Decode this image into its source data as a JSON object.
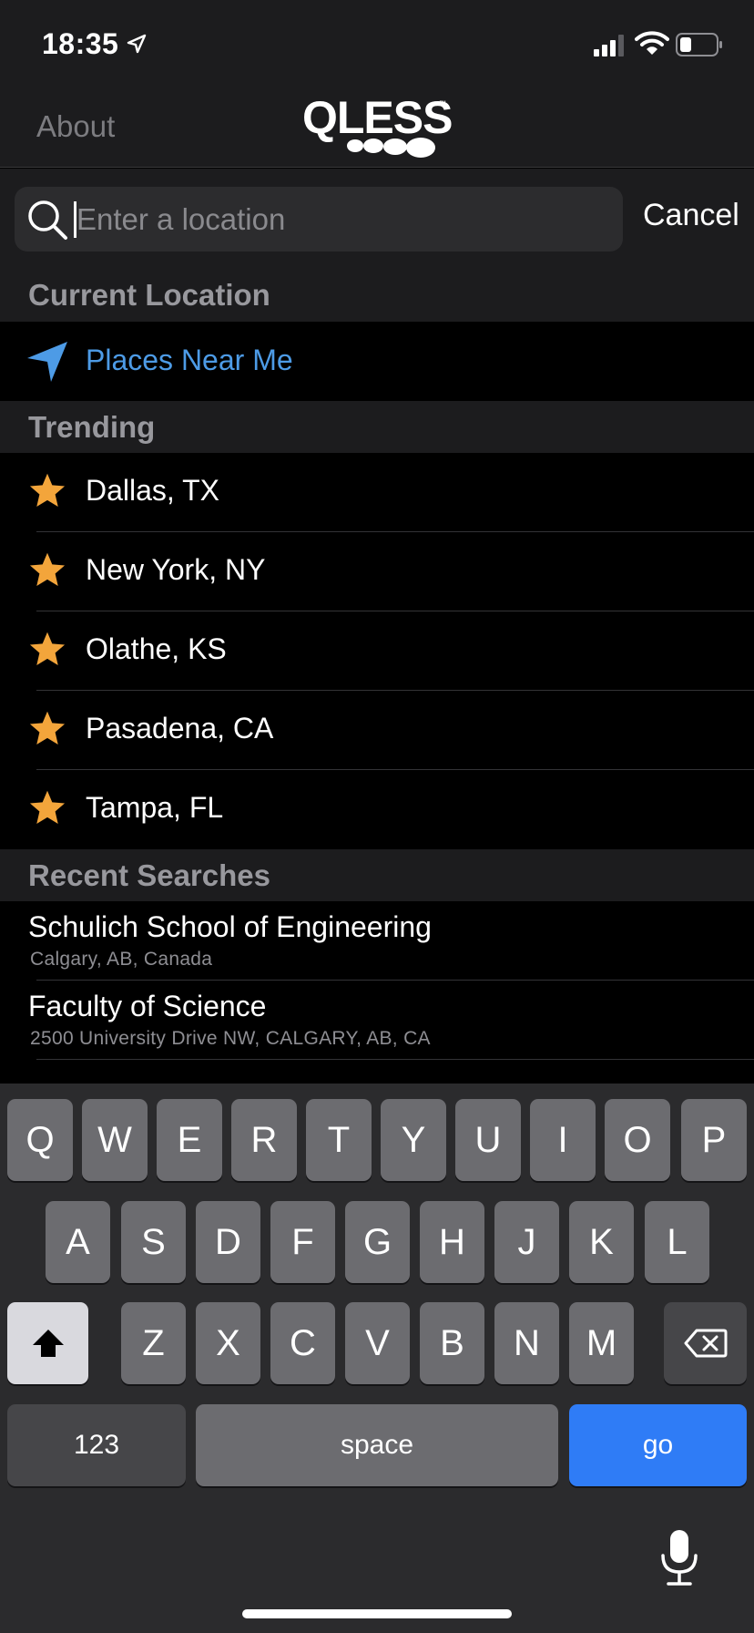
{
  "status_bar": {
    "time": "18:35"
  },
  "nav": {
    "about_label": "About",
    "logo_text": "QLESS",
    "logo_tm": "™"
  },
  "search": {
    "placeholder": "Enter a location",
    "value": "",
    "cancel_label": "Cancel"
  },
  "sections": {
    "current_location": "Current Location",
    "trending": "Trending",
    "recent": "Recent Searches"
  },
  "current_location": {
    "label": "Places Near Me"
  },
  "trending": [
    {
      "label": "Dallas, TX"
    },
    {
      "label": "New York, NY"
    },
    {
      "label": "Olathe, KS"
    },
    {
      "label": "Pasadena, CA"
    },
    {
      "label": "Tampa, FL"
    }
  ],
  "recent_searches": [
    {
      "title": "Schulich School of Engineering",
      "subtitle": "Calgary, AB, Canada"
    },
    {
      "title": "Faculty of Science",
      "subtitle": "2500 University Drive NW, CALGARY, AB, CA"
    }
  ],
  "keyboard": {
    "row1": [
      "Q",
      "W",
      "E",
      "R",
      "T",
      "Y",
      "U",
      "I",
      "O",
      "P"
    ],
    "row2": [
      "A",
      "S",
      "D",
      "F",
      "G",
      "H",
      "J",
      "K",
      "L"
    ],
    "row3": [
      "Z",
      "X",
      "C",
      "V",
      "B",
      "N",
      "M"
    ],
    "numbers_label": "123",
    "space_label": "space",
    "go_label": "go"
  },
  "colors": {
    "accent_blue": "#4d9be6",
    "star_orange": "#f3a53b",
    "go_key_blue": "#2f7cf6"
  },
  "icons": {
    "location": "location-arrow-icon",
    "signal": "cellular-signal-icon",
    "wifi": "wifi-icon",
    "battery": "battery-icon",
    "search": "search-icon",
    "near_me": "navigation-arrow-icon",
    "trending": "star-icon",
    "shift": "shift-icon",
    "delete": "backspace-icon",
    "mic": "microphone-icon"
  }
}
